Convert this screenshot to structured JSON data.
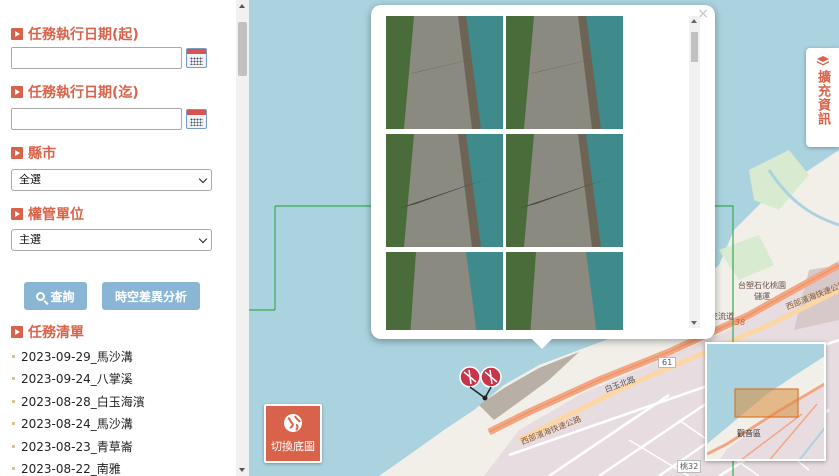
{
  "sidebar": {
    "start_date_label": "任務執行日期(起)",
    "end_date_label": "任務執行日期(迄)",
    "county_label": "縣市",
    "county_value": "全選",
    "authority_label": "權管單位",
    "authority_value": "主選",
    "search_button": "查詢",
    "analysis_button": "時空差異分析",
    "task_list_label": "任務清單",
    "tasks": [
      "2023-09-29_馬沙溝",
      "2023-09-24_八掌溪",
      "2023-08-28_白玉海濱",
      "2023-08-24_馬沙溝",
      "2023-08-23_青草崙",
      "2023-08-22_南雅"
    ]
  },
  "map": {
    "expand_info_label": "擴充資訊",
    "switch_basemap_label": "切換底圖",
    "labels": {
      "road_west_coast": "西部濱海快速公路",
      "road_61": "61",
      "road_32": "桃32",
      "road_38": "38",
      "baiyu": "白玉北路",
      "cpc": "台塑石化桃園儲運",
      "district": "觀音區",
      "keyuan": "桃科交流道"
    }
  },
  "colors": {
    "accent": "#d9634a",
    "button": "#8ab6d6",
    "water": "#aad3df",
    "land": "#f2efe9"
  }
}
